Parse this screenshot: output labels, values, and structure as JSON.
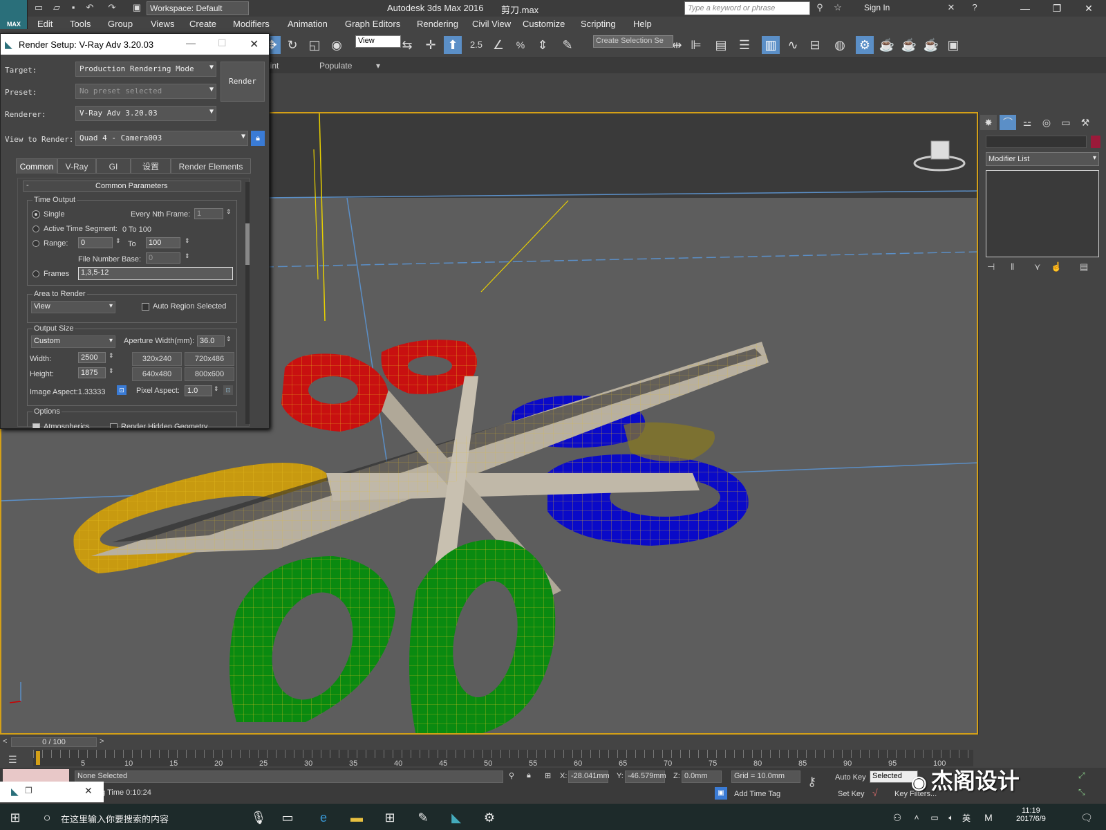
{
  "app": {
    "title": "Autodesk 3ds Max 2016",
    "file": "剪刀.max",
    "logo": "MAX",
    "workspace": "Workspace: Default",
    "search_placeholder": "Type a keyword or phrase",
    "signin": "Sign In"
  },
  "menu": [
    "Edit",
    "Tools",
    "Group",
    "Views",
    "Create",
    "Modifiers",
    "Animation",
    "Graph Editors",
    "Rendering",
    "Civil View",
    "Customize",
    "Scripting",
    "Help"
  ],
  "toolbar": {
    "view": "View",
    "create_selection": "Create Selection Se",
    "snap_value": "2.5"
  },
  "ribbon": {
    "tab1": "aint",
    "tab2": "Populate"
  },
  "render_setup": {
    "title": "Render Setup: V-Ray Adv 3.20.03",
    "target_label": "Target:",
    "target": "Production Rendering Mode",
    "preset_label": "Preset:",
    "preset": "No preset selected",
    "renderer_label": "Renderer:",
    "renderer": "V-Ray Adv 3.20.03",
    "view_label": "View to Render:",
    "view": "Quad 4 - Camera003",
    "render_button": "Render",
    "tabs": [
      "Common",
      "V-Ray",
      "GI",
      "设置",
      "Render Elements"
    ],
    "rollout": "Common Parameters",
    "rollout_collapse": "-",
    "time_output": "Time Output",
    "single": "Single",
    "every_nth": "Every Nth Frame:",
    "every_nth_val": "1",
    "active_segment": "Active Time Segment:",
    "active_segment_val": "0 To 100",
    "range": "Range:",
    "range_from": "0",
    "range_to_label": "To",
    "range_to": "100",
    "file_number_base": "File Number Base:",
    "file_number_base_val": "0",
    "frames": "Frames",
    "frames_val": "1,3,5-12",
    "area_to_render": "Area to Render",
    "area_val": "View",
    "auto_region": "Auto Region Selected",
    "output_size": "Output Size",
    "output_val": "Custom",
    "aperture": "Aperture Width(mm):",
    "aperture_val": "36.0",
    "width_label": "Width:",
    "width_val": "2500",
    "height_label": "Height:",
    "height_val": "1875",
    "presets": [
      "320x240",
      "720x486",
      "640x480",
      "800x600"
    ],
    "image_aspect": "Image Aspect:1.33333",
    "pixel_aspect": "Pixel Aspect:",
    "pixel_aspect_val": "1.0",
    "options": "Options",
    "atmospherics": "Atmospherics",
    "render_hidden": "Render Hidden Geometry"
  },
  "right_panel": {
    "modifier_list": "Modifier List"
  },
  "timeline": {
    "slider": "0 / 100",
    "ticks": [
      "5",
      "10",
      "15",
      "20",
      "25",
      "30",
      "35",
      "40",
      "45",
      "50",
      "55",
      "60",
      "65",
      "70",
      "75",
      "80",
      "85",
      "90",
      "95",
      "100"
    ]
  },
  "status": {
    "none_selected": "None Selected",
    "rendering_time": "ng Time  0:10:24",
    "x_label": "X:",
    "x_val": "-28.041mm",
    "y_label": "Y:",
    "y_val": "-46.579mm",
    "z_label": "Z:",
    "z_val": "0.0mm",
    "grid": "Grid = 10.0mm",
    "add_time_tag": "Add Time Tag",
    "auto_key": "Auto Key",
    "set_key": "Set Key",
    "selected": "Selected",
    "key_filters": "Key Filters..."
  },
  "taskbar": {
    "search": "在这里输入你要搜索的内容",
    "ime": "英",
    "time": "11:19",
    "date": "2017/6/9"
  },
  "watermark": "杰阁设计"
}
